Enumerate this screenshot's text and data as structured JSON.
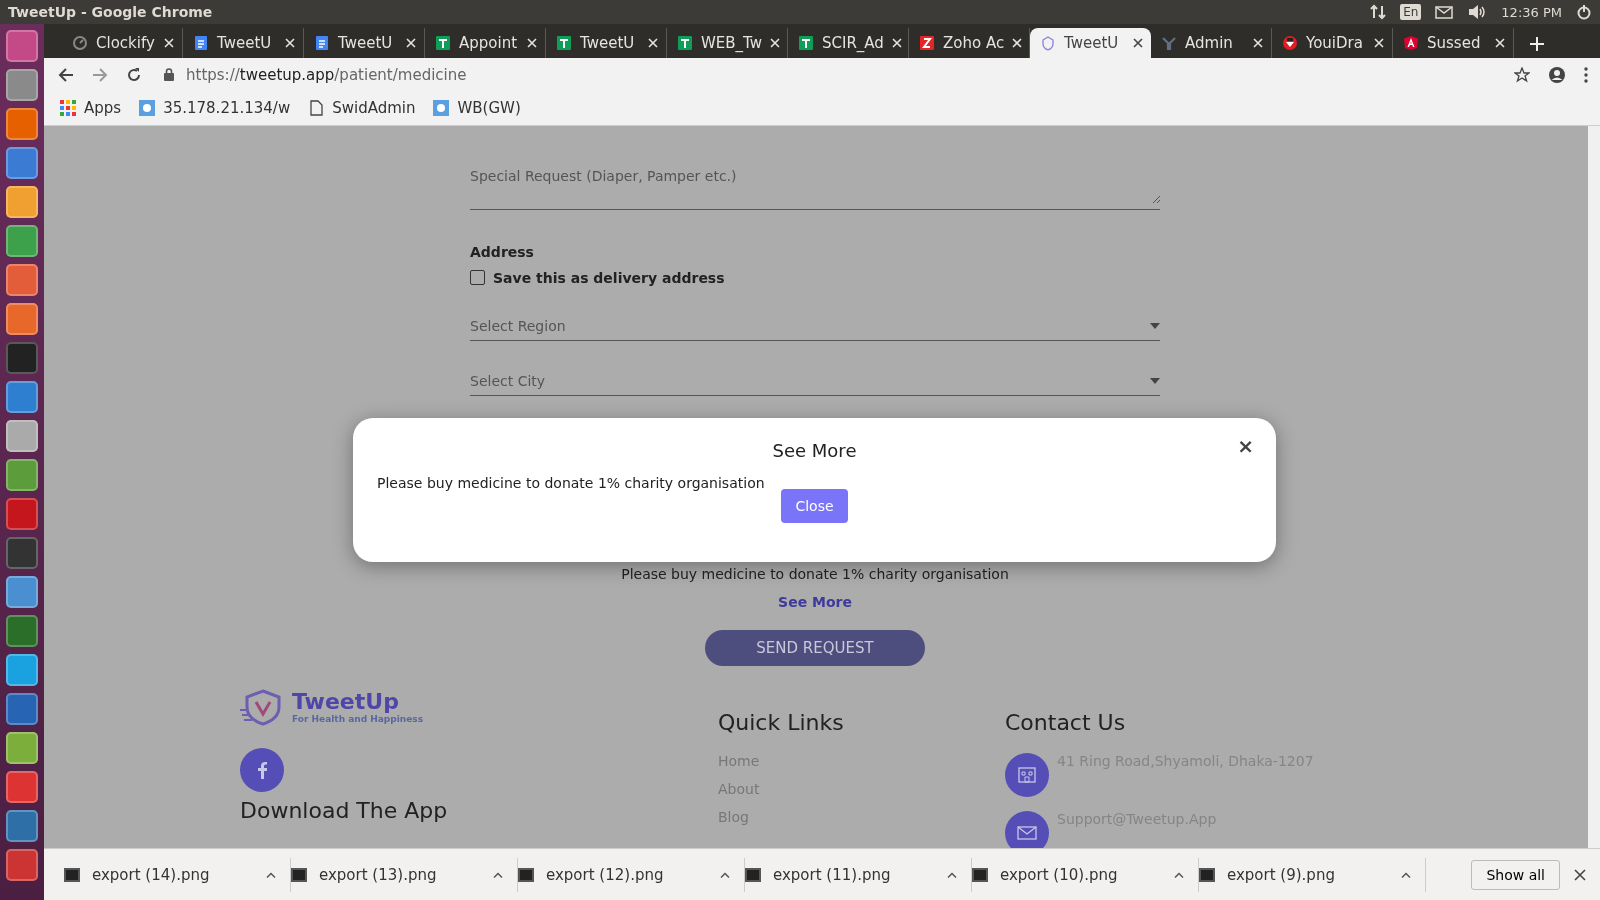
{
  "os_bar": {
    "title": "TweetUp - Google Chrome",
    "keyboard": "En",
    "clock": "12:36 PM"
  },
  "tabs": [
    {
      "label": "Clockify",
      "kind": "clock",
      "selected": false
    },
    {
      "label": "TweetU",
      "kind": "doc",
      "selected": false
    },
    {
      "label": "TweetU",
      "kind": "doc",
      "selected": false
    },
    {
      "label": "Appoint",
      "kind": "sheet",
      "selected": false
    },
    {
      "label": "TweetU",
      "kind": "sheet",
      "selected": false
    },
    {
      "label": "WEB_Tw",
      "kind": "sheet",
      "selected": false
    },
    {
      "label": "SCIR_Ad",
      "kind": "sheet",
      "selected": false
    },
    {
      "label": "Zoho Ac",
      "kind": "zoho",
      "selected": false
    },
    {
      "label": "TweetU",
      "kind": "tweetup",
      "selected": true
    },
    {
      "label": "Admin",
      "kind": "admin",
      "selected": false
    },
    {
      "label": "YouiDra",
      "kind": "youi",
      "selected": false
    },
    {
      "label": "Sussed",
      "kind": "angular",
      "selected": false
    }
  ],
  "address": {
    "scheme": "https://",
    "host": "tweetup.app",
    "path": "/patient/medicine"
  },
  "bookmarks": [
    {
      "label": "Apps",
      "kind": "apps"
    },
    {
      "label": "35.178.21.134/w",
      "kind": "site"
    },
    {
      "label": "SwidAdmin",
      "kind": "page"
    },
    {
      "label": "WB(GW)",
      "kind": "site"
    }
  ],
  "form": {
    "special_request": {
      "placeholder": "Special Request (Diaper, Pamper etc.)"
    },
    "address_label": "Address",
    "save_address": {
      "label": "Save this as delivery address",
      "checked": false
    },
    "region": {
      "placeholder": "Select Region"
    },
    "city": {
      "placeholder": "Select City"
    },
    "notice": "Please buy medicine to donate 1% charity organisation",
    "see_more": "See More",
    "submit": "SEND REQUEST"
  },
  "footer": {
    "brand": "TweetUp",
    "tagline": "For Health and Happiness",
    "download_heading": "Download The App",
    "quick_links_heading": "Quick Links",
    "quick_links": [
      "Home",
      "About",
      "Blog"
    ],
    "contact_heading": "Contact Us",
    "contacts": [
      {
        "kind": "address",
        "text": "41 Ring Road,Shyamoli, Dhaka-1207"
      },
      {
        "kind": "email",
        "text": "Support@Tweetup.App"
      }
    ]
  },
  "modal": {
    "title": "See More",
    "dismiss": "×",
    "message": "Please buy medicine to donate 1% charity organisation",
    "close_button": "Close"
  },
  "downloads": {
    "files": [
      "export (14).png",
      "export (13).png",
      "export (12).png",
      "export (11).png",
      "export (10).png",
      "export (9).png"
    ],
    "show_all": "Show all"
  }
}
